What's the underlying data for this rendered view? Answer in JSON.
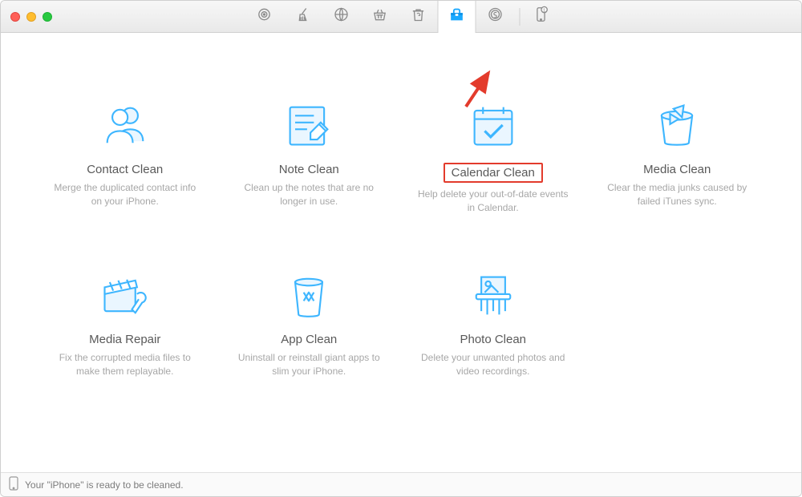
{
  "window": {
    "status_text": "Your \"iPhone\" is ready to be cleaned.",
    "device_badge": "1"
  },
  "toolbar": {
    "tabs": {
      "target": "target-icon",
      "sweep": "sweep-icon",
      "globe": "globe-icon",
      "basket": "basket-icon",
      "recycle": "recycle-icon",
      "tools": "toolbox-icon",
      "coin": "coin-icon"
    }
  },
  "tiles": {
    "contact": {
      "title": "Contact Clean",
      "desc": "Merge the duplicated contact info on your iPhone."
    },
    "note": {
      "title": "Note Clean",
      "desc": "Clean up the notes that are no longer in use."
    },
    "calendar": {
      "title": "Calendar Clean",
      "desc": "Help delete your out-of-date events in Calendar."
    },
    "media": {
      "title": "Media Clean",
      "desc": "Clear the media junks caused by failed iTunes sync."
    },
    "repair": {
      "title": "Media Repair",
      "desc": "Fix the corrupted media files to make them replayable."
    },
    "app": {
      "title": "App Clean",
      "desc": "Uninstall or reinstall giant apps to slim your iPhone."
    },
    "photo": {
      "title": "Photo Clean",
      "desc": "Delete your unwanted photos and video recordings."
    }
  },
  "annotations": {
    "arrow_color": "#e33b2c",
    "highlight_color": "#e33b2c"
  }
}
